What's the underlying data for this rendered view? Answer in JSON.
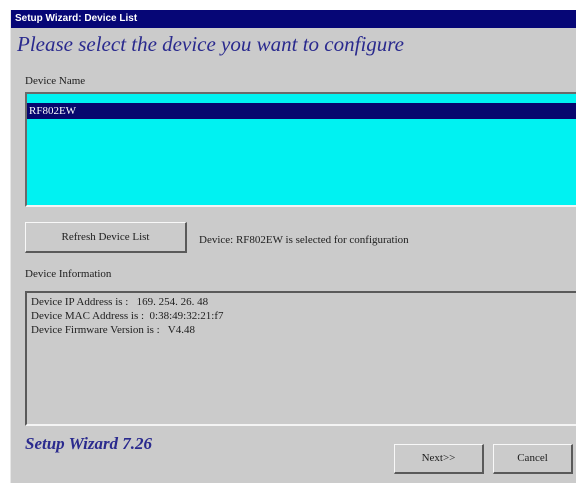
{
  "window": {
    "title": "Setup Wizard: Device List"
  },
  "heading": "Please select the device you want to configure",
  "device_list": {
    "label": "Device Name",
    "items": [
      "RF802EW"
    ],
    "selected_index": 0
  },
  "refresh_button": "Refresh Device List",
  "status_text": "Device: RF802EW is selected for configuration",
  "device_info": {
    "label": "Device Information",
    "lines": [
      "Device IP Address is :   169. 254. 26. 48",
      "Device MAC Address is :  0:38:49:32:21:f7",
      "Device Firmware Version is :   V4.48"
    ]
  },
  "footer_title": "Setup Wizard 7.26",
  "buttons": {
    "next": "Next>>",
    "cancel": "Cancel"
  },
  "colors": {
    "title_bar": "#060676",
    "list_background": "#00f2f2",
    "selection": "#07076e",
    "heading_text": "#2a2a8e",
    "window_background": "#cbcbcb"
  }
}
